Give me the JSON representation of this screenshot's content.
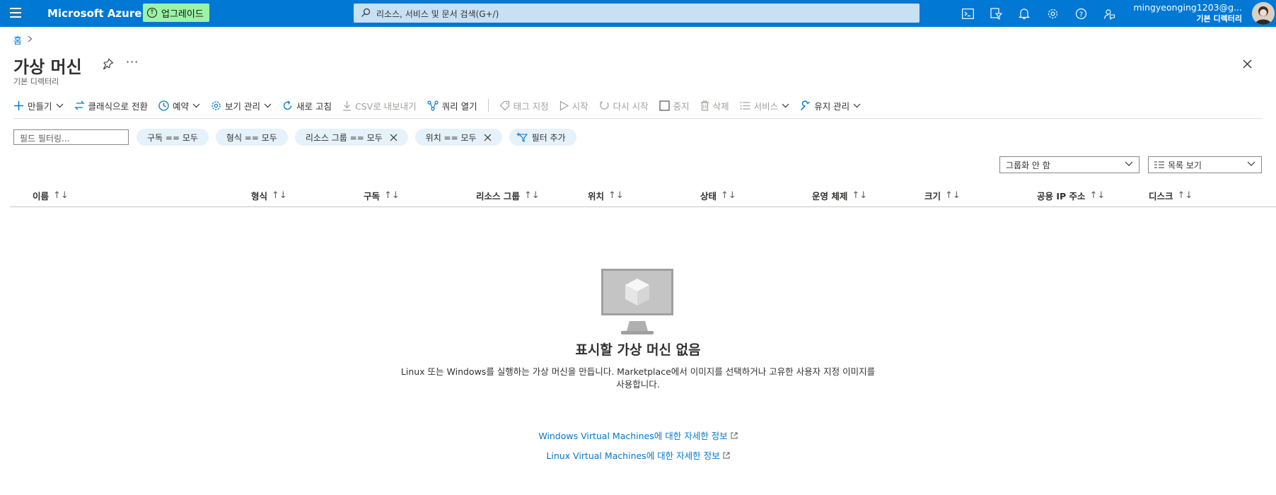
{
  "topbar": {
    "brand": "Microsoft Azure",
    "upgrade_label": "업그레이드",
    "search_placeholder": "리소스, 서비스 및 문서 검색(G+/)",
    "user_email": "mingyeonging1203@g...",
    "user_directory": "기본 디렉터리",
    "icons": [
      "cloud-shell-icon",
      "directory-filter-icon",
      "notification-bell-icon",
      "settings-gear-icon",
      "help-question-icon",
      "feedback-icon"
    ]
  },
  "breadcrumb": {
    "home": "홈"
  },
  "page": {
    "title": "가상 머신",
    "subtitle": "기본 디렉터리"
  },
  "toolbar": {
    "create": "만들기",
    "switch_classic": "클래식으로 전환",
    "reservations": "예약",
    "manage_view": "보기 관리",
    "refresh": "새로 고침",
    "export_csv": "CSV로 내보내기",
    "open_query": "쿼리 열기",
    "assign_tags": "태그 지정",
    "start": "시작",
    "restart": "다시 시작",
    "stop": "중지",
    "delete": "삭제",
    "services": "서비스",
    "maintenance": "유지 관리"
  },
  "filters": {
    "field_placeholder": "필드 필터링...",
    "subscription": "구독 == 모두",
    "type": "형식 == 모두",
    "resource_group": "리소스 그룹 == 모두",
    "location": "위치 == 모두",
    "add_filter": "필터 추가"
  },
  "grouping": {
    "selected": "그룹화 안 함"
  },
  "view": {
    "selected": "목록 보기"
  },
  "table": {
    "columns": [
      "이름",
      "형식",
      "구독",
      "리소스 그룹",
      "위치",
      "상태",
      "운영 체제",
      "크기",
      "공용 IP 주소",
      "디스크"
    ]
  },
  "empty": {
    "title": "표시할 가상 머신 없음",
    "description": "Linux 또는 Windows를 실행하는 가상 머신을 만듭니다. Marketplace에서 이미지를 선택하거나 고유한 사용자 지정 이미지를 사용합니다.",
    "link_windows": "Windows Virtual Machines에 대한 자세한 정보",
    "link_linux": "Linux Virtual Machines에 대한 자세한 정보"
  },
  "colors": {
    "brand": "#0078d4",
    "upgrade": "#9bf3a6",
    "pill": "#e5f1fb"
  }
}
